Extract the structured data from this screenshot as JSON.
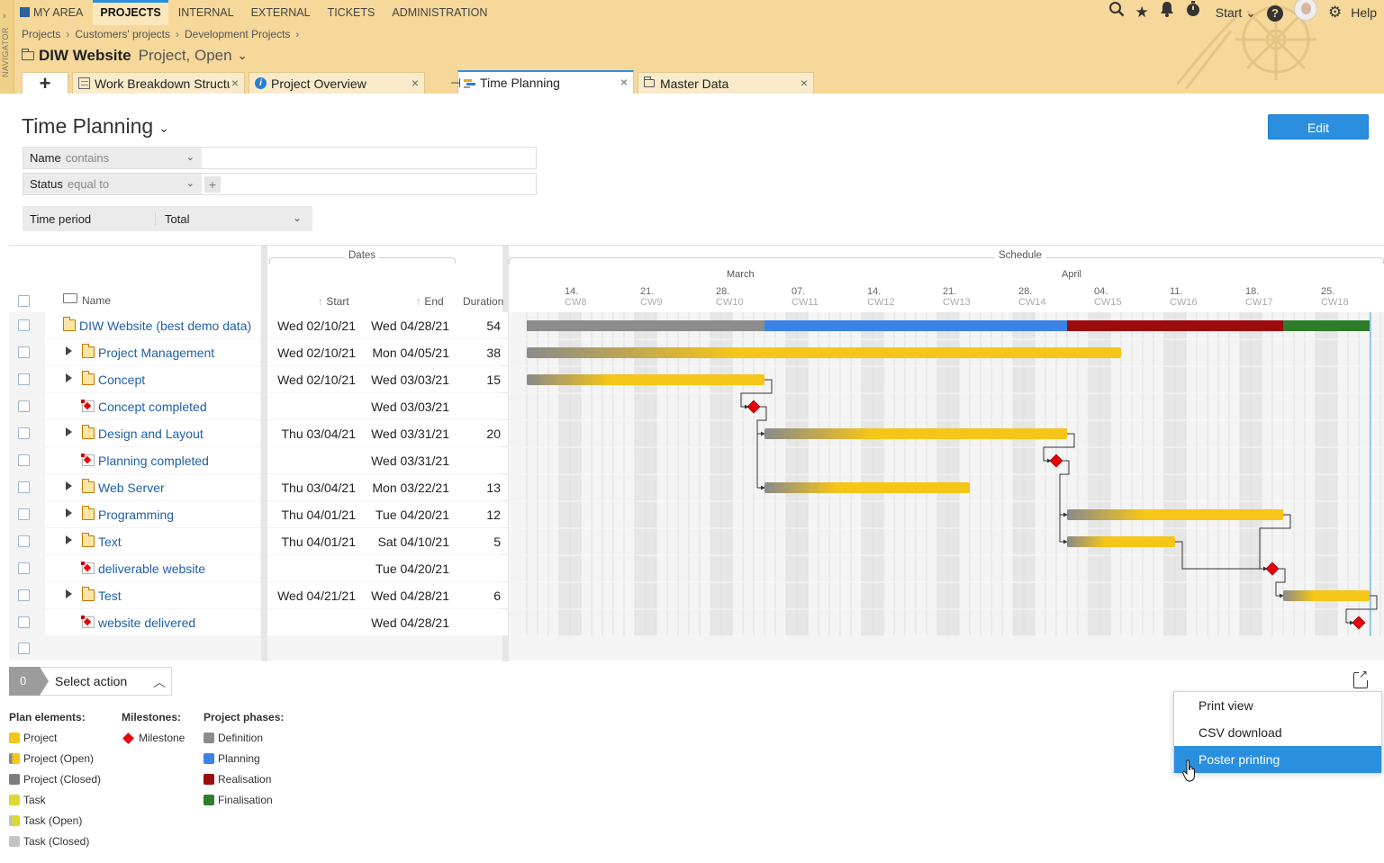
{
  "nav": {
    "rail_label": "NAVIGATOR",
    "items": [
      {
        "label": "MY AREA",
        "active": false
      },
      {
        "label": "PROJECTS",
        "active": true
      },
      {
        "label": "INTERNAL",
        "active": false
      },
      {
        "label": "EXTERNAL",
        "active": false
      },
      {
        "label": "TICKETS",
        "active": false
      },
      {
        "label": "ADMINISTRATION",
        "active": false
      }
    ],
    "start_label": "Start",
    "help_label": "Help"
  },
  "breadcrumb": [
    "Projects",
    "Customers' projects",
    "Development Projects"
  ],
  "object": {
    "name": "DIW Website",
    "status": "Project, Open"
  },
  "tabs": [
    {
      "label": "Work Breakdown Structure",
      "icon": "wbs-icon"
    },
    {
      "label": "Project Overview",
      "icon": "info-icon"
    },
    {
      "label": "Time Planning",
      "icon": "gantt-icon"
    },
    {
      "label": "Master Data",
      "icon": "folder-icon"
    }
  ],
  "page": {
    "title": "Time Planning",
    "edit_label": "Edit"
  },
  "filters": [
    {
      "field": "Name",
      "operator": "contains",
      "value": ""
    },
    {
      "field": "Status",
      "operator": "equal to",
      "value": ""
    }
  ],
  "time_period": {
    "label": "Time period",
    "value": "Total"
  },
  "table": {
    "headers": {
      "name": "Name",
      "dates_group": "Dates",
      "start": "Start",
      "end": "End",
      "duration": "Duration",
      "schedule_group": "Schedule"
    },
    "months": [
      "March",
      "April"
    ],
    "weeks": [
      {
        "day": "14.",
        "cw": "CW8"
      },
      {
        "day": "21.",
        "cw": "CW9"
      },
      {
        "day": "28.",
        "cw": "CW10"
      },
      {
        "day": "07.",
        "cw": "CW11"
      },
      {
        "day": "14.",
        "cw": "CW12"
      },
      {
        "day": "21.",
        "cw": "CW13"
      },
      {
        "day": "28.",
        "cw": "CW14"
      },
      {
        "day": "04.",
        "cw": "CW15"
      },
      {
        "day": "11.",
        "cw": "CW16"
      },
      {
        "day": "18.",
        "cw": "CW17"
      },
      {
        "day": "25.",
        "cw": "CW18"
      }
    ],
    "rows": [
      {
        "name": "DIW Website (best demo data)",
        "type": "root",
        "start": "Wed 02/10/21",
        "end": "Wed 04/28/21",
        "duration": "54"
      },
      {
        "name": "Project Management",
        "type": "folder",
        "start": "Wed 02/10/21",
        "end": "Mon 04/05/21",
        "duration": "38"
      },
      {
        "name": "Concept",
        "type": "folder",
        "start": "Wed 02/10/21",
        "end": "Wed 03/03/21",
        "duration": "15"
      },
      {
        "name": "Concept completed",
        "type": "milestone",
        "start": "",
        "end": "Wed 03/03/21",
        "duration": ""
      },
      {
        "name": "Design and Layout",
        "type": "folder",
        "start": "Thu 03/04/21",
        "end": "Wed 03/31/21",
        "duration": "20"
      },
      {
        "name": "Planning completed",
        "type": "milestone",
        "start": "",
        "end": "Wed 03/31/21",
        "duration": ""
      },
      {
        "name": "Web Server",
        "type": "folder",
        "start": "Thu 03/04/21",
        "end": "Mon 03/22/21",
        "duration": "13"
      },
      {
        "name": "Programming",
        "type": "folder",
        "start": "Thu 04/01/21",
        "end": "Tue 04/20/21",
        "duration": "12"
      },
      {
        "name": "Text",
        "type": "folder",
        "start": "Thu 04/01/21",
        "end": "Sat 04/10/21",
        "duration": "5"
      },
      {
        "name": "deliverable website",
        "type": "milestone",
        "start": "",
        "end": "Tue 04/20/21",
        "duration": ""
      },
      {
        "name": "Test",
        "type": "folder",
        "start": "Wed 04/21/21",
        "end": "Wed 04/28/21",
        "duration": "6"
      },
      {
        "name": "website delivered",
        "type": "milestone",
        "start": "",
        "end": "Wed 04/28/21",
        "duration": ""
      }
    ]
  },
  "actions": {
    "selected_count": "0",
    "label": "Select action"
  },
  "export_menu": {
    "options": [
      "Print view",
      "CSV download",
      "Poster printing"
    ],
    "highlighted": "Poster printing"
  },
  "legend": {
    "plan_elements": {
      "title": "Plan elements:",
      "items": [
        {
          "label": "Project",
          "color": "#f5c518"
        },
        {
          "label": "Project (Open)",
          "color": "#f5c518",
          "edge": "#8a8a8a"
        },
        {
          "label": "Project (Closed)",
          "color": "#7d7d7d"
        },
        {
          "label": "Task",
          "color": "#dcd82e"
        },
        {
          "label": "Task (Open)",
          "color": "#dcd82e",
          "edge": "#c0c0c0"
        },
        {
          "label": "Task (Closed)",
          "color": "#c4c4c4"
        }
      ]
    },
    "milestones": {
      "title": "Milestones:",
      "items": [
        {
          "label": "Milestone",
          "color": "#e8000a"
        }
      ]
    },
    "phases": {
      "title": "Project phases:",
      "items": [
        {
          "label": "Definition",
          "color": "#8c8c8c"
        },
        {
          "label": "Planning",
          "color": "#3b82e6"
        },
        {
          "label": "Realisation",
          "color": "#9b0c0c"
        },
        {
          "label": "Finalisation",
          "color": "#2e7d2a"
        }
      ]
    }
  },
  "colors": {
    "accent": "#2b8fe0",
    "header": "#f5d89a",
    "bar": "#f5c518",
    "milestone": "#e8000a",
    "link": "#1f5fa8"
  }
}
